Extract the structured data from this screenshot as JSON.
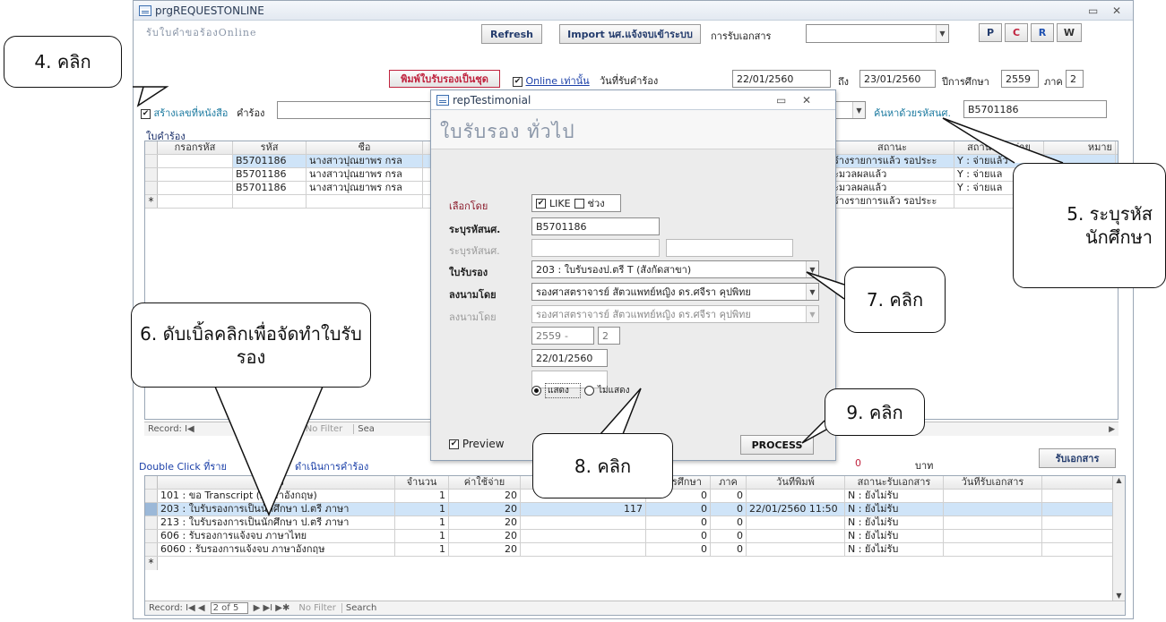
{
  "main_window": {
    "title": "prgREQUESTONLINE",
    "heading": "รับใบคำขอร้องOnline",
    "refresh_label": "Refresh",
    "import_label": "Import นศ.แจ้งจบเข้าระบบ",
    "doc_receive_label": "การรับเอกสาร",
    "doc_receive_value": "",
    "letter_buttons": [
      "P",
      "C",
      "R",
      "W"
    ],
    "print_batch_label": "พิมพ์ใบรับรองเป็นชุด",
    "online_only_label": "Online เท่านั้น",
    "date_received_label": "วันที่รับคำร้อง",
    "date_from": "22/01/2560",
    "to_label": "ถึง",
    "date_to": "23/01/2560",
    "academic_year_label": "ปีการศึกษา",
    "academic_year": "2559",
    "term_label": "ภาค",
    "term": "2",
    "create_doc_no_label": "สร้างเลขที่หนังสือ",
    "request_label": "คำร้อง",
    "search_by_id_label": "ค้นหาด้วยรหัสนศ.",
    "search_id_value": "B5701186",
    "section_label": "ใบคำร้อง",
    "double_click_label": "Double Click ที่ราย",
    "double_click_label2": "ดำเนินการคำร้อง",
    "amount_value": "0",
    "baht_label": "บาท",
    "receive_doc_button": "รับเอกสาร"
  },
  "request_grid": {
    "headers": [
      "กรอกรหัส",
      "รหัส",
      "ชื่อ",
      "สถานะ",
      "สถานะการจ่าย",
      "หมาย"
    ],
    "rows": [
      {
        "id": "B5701186",
        "name": "นางสาวปุณยาพร กรล",
        "status": "ร้างรายการแล้ว รอประะ",
        "pay": "Y : จ่ายแล้ว"
      },
      {
        "id": "B5701186",
        "name": "นางสาวปุณยาพร กรล",
        "status": "ะมวลผลแล้ว",
        "pay": "Y : จ่ายแล"
      },
      {
        "id": "B5701186",
        "name": "นางสาวปุณยาพร กรล",
        "status": "ะมวลผลแล้ว",
        "pay": "Y : จ่ายแล"
      },
      {
        "id": "",
        "name": "",
        "status": "ร้างรายการแล้ว รอประะ",
        "pay": ""
      }
    ],
    "new_row_marker": "*",
    "record_label": "Record: I◀",
    "no_filter": "No Filter",
    "search_label": "Sea"
  },
  "cert_grid": {
    "headers": [
      "รอง",
      "จำนวน",
      "ค่าใช้จ่าย",
      "",
      "ปีการศึกษา",
      "ภาค",
      "วันที่พิมพ์",
      "สถานะรับเอกสาร",
      "วันที่รับเอกสาร"
    ],
    "rows": [
      {
        "name": "101 : ขอ Transcript (ภาษาอังกฤษ)",
        "qty": "1",
        "cost": "20",
        "extra": "",
        "year": "0",
        "term": "0",
        "printed": "",
        "status": "N : ยังไม่รับ"
      },
      {
        "name": "203 : ใบรับรองการเป็นนักศึกษา ป.ตรี ภาษา",
        "qty": "1",
        "cost": "20",
        "extra": "117",
        "year": "0",
        "term": "0",
        "printed": "22/01/2560 11:50",
        "status": "N : ยังไม่รับ"
      },
      {
        "name": "213 : ใบรับรองการเป็นนักศึกษา ป.ตรี ภาษา",
        "qty": "1",
        "cost": "20",
        "extra": "",
        "year": "0",
        "term": "0",
        "printed": "",
        "status": "N : ยังไม่รับ"
      },
      {
        "name": "606 : รับรองการแจ้งจบ ภาษาไทย",
        "qty": "1",
        "cost": "20",
        "extra": "",
        "year": "0",
        "term": "0",
        "printed": "",
        "status": "N : ยังไม่รับ"
      },
      {
        "name": "6060 : รับรองการแจ้งจบ ภาษาอังกฤษ",
        "qty": "1",
        "cost": "20",
        "extra": "",
        "year": "0",
        "term": "0",
        "printed": "",
        "status": "N : ยังไม่รับ"
      }
    ],
    "new_row_marker": "*",
    "record_label": "Record: I◀ ◀",
    "record_value": "2 of 5",
    "record_nav": "▶ ▶I ▶✱",
    "no_filter": "No Filter",
    "search_label": "Search"
  },
  "dialog": {
    "title": "repTestimonial",
    "heading": "ใบรับรอง ทั่วไป",
    "select_by_label": "เลือกโดย",
    "like_label": "LIKE",
    "range_label": "ช่วง",
    "student_id_label": "ระบุรหัสนศ.",
    "student_id_value": "B5701186",
    "student_id_label_disabled": "ระบุรหัสนศ.",
    "cert_label": "ใบรับรอง",
    "cert_value": "203 : ใบรับรองป.ตรี T (สังกัดสาขา)",
    "signed_by_label": "ลงนามโดย",
    "signed_by_value": "รองศาสตราจารย์ สัตวแพทย์หญิง ดร.ศจีรา คุปพิทย",
    "signed_by_label_disabled": "ลงนามโดย",
    "signed_by_value_disabled": "รองศาสตราจารย์ สัตวแพทย์หญิง ดร.ศจีรา คุปพิทย",
    "year_value": "2559",
    "dash": "-",
    "term_value": "2",
    "date_value": "22/01/2560",
    "show_label": "แสดง",
    "hide_label": "ไม่แสดง",
    "preview_label": "Preview",
    "process_label": "PROCESS"
  },
  "callouts": {
    "c4": "4. คลิก",
    "c5_line1": "5. ระบุรหัส",
    "c5_line2": "นักศึกษา",
    "c6": "6. ดับเบิ้ลคลิกเพื่อจัดทำใบรับรอง",
    "c7": "7. คลิก",
    "c8": "8. คลิก",
    "c9": "9. คลิก"
  }
}
